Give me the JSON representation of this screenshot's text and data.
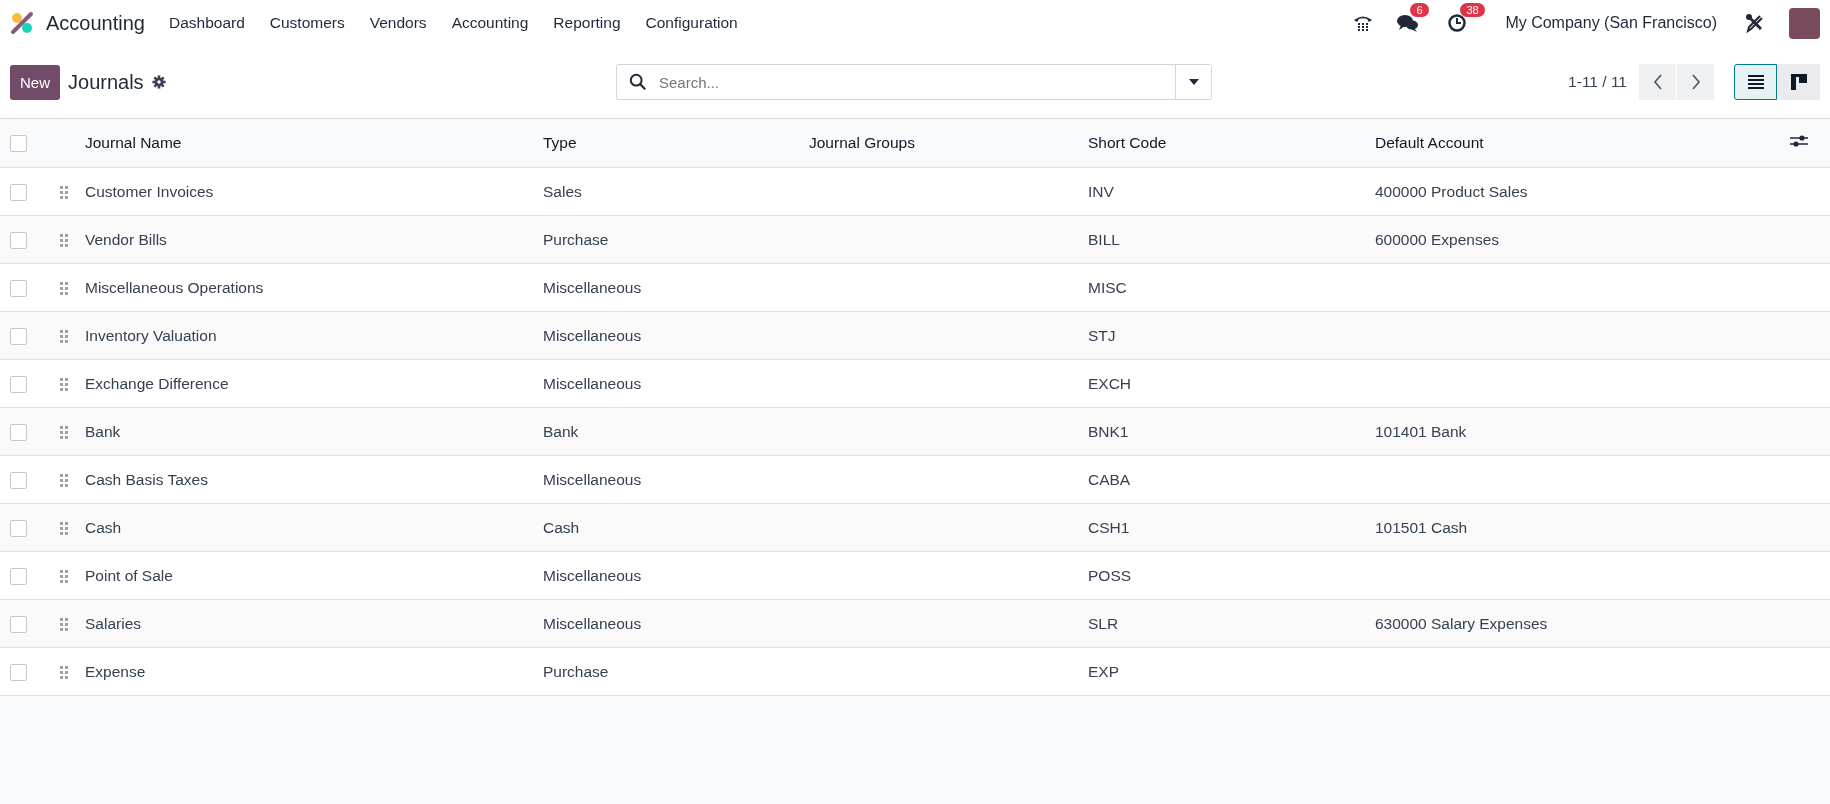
{
  "app": {
    "name": "Accounting"
  },
  "menu": [
    "Dashboard",
    "Customers",
    "Vendors",
    "Accounting",
    "Reporting",
    "Configuration"
  ],
  "systray": {
    "messages_count": "6",
    "activities_count": "38",
    "company": "My Company (San Francisco)"
  },
  "control_panel": {
    "new_button": "New",
    "title": "Journals",
    "search": {
      "placeholder": "Search..."
    },
    "pager": "1-11 / 11",
    "views": [
      {
        "kind": "list",
        "selected": true
      },
      {
        "kind": "kanban",
        "selected": false
      }
    ]
  },
  "table": {
    "all_checked": false,
    "columns": [
      "Journal Name",
      "Type",
      "Journal Groups",
      "Short Code",
      "Default Account"
    ],
    "rows": [
      {
        "checked": false,
        "cells": [
          "Customer Invoices",
          "Sales",
          "",
          "INV",
          "400000 Product Sales"
        ]
      },
      {
        "checked": false,
        "cells": [
          "Vendor Bills",
          "Purchase",
          "",
          "BILL",
          "600000 Expenses"
        ]
      },
      {
        "checked": false,
        "cells": [
          "Miscellaneous Operations",
          "Miscellaneous",
          "",
          "MISC",
          ""
        ]
      },
      {
        "checked": false,
        "cells": [
          "Inventory Valuation",
          "Miscellaneous",
          "",
          "STJ",
          ""
        ]
      },
      {
        "checked": false,
        "cells": [
          "Exchange Difference",
          "Miscellaneous",
          "",
          "EXCH",
          ""
        ]
      },
      {
        "checked": false,
        "cells": [
          "Bank",
          "Bank",
          "",
          "BNK1",
          "101401 Bank"
        ]
      },
      {
        "checked": false,
        "cells": [
          "Cash Basis Taxes",
          "Miscellaneous",
          "",
          "CABA",
          ""
        ]
      },
      {
        "checked": false,
        "cells": [
          "Cash",
          "Cash",
          "",
          "CSH1",
          "101501 Cash"
        ]
      },
      {
        "checked": false,
        "cells": [
          "Point of Sale",
          "Miscellaneous",
          "",
          "POSS",
          ""
        ]
      },
      {
        "checked": false,
        "cells": [
          "Salaries",
          "Miscellaneous",
          "",
          "SLR",
          "630000 Salary Expenses"
        ]
      },
      {
        "checked": false,
        "cells": [
          "Expense",
          "Purchase",
          "",
          "EXP",
          ""
        ]
      }
    ]
  }
}
